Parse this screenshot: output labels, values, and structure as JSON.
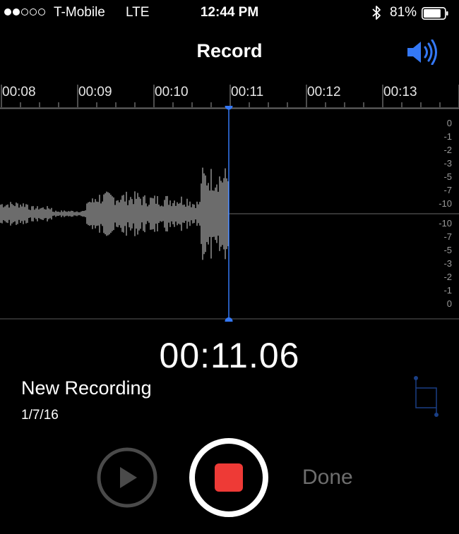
{
  "status_bar": {
    "carrier": "T-Mobile",
    "network": "LTE",
    "time": "12:44 PM",
    "battery_percent": "81%",
    "signal_bars_filled": 2,
    "signal_bars_total": 5,
    "battery_level": 0.81
  },
  "nav": {
    "title": "Record",
    "speaker_icon": "speaker-icon"
  },
  "timeline": {
    "labels": [
      "00:08",
      "00:09",
      "00:10",
      "00:11",
      "00:12",
      "00:13"
    ]
  },
  "meter": {
    "db_labels_top": [
      "0",
      "-1",
      "-2",
      "-3",
      "-5",
      "-7",
      "-10"
    ],
    "db_labels_bottom": [
      "-10",
      "-7",
      "-5",
      "-3",
      "-2",
      "-1",
      "0"
    ]
  },
  "timer": "00:11.06",
  "recording": {
    "name": "New Recording",
    "date": "1/7/16"
  },
  "controls": {
    "done_label": "Done",
    "play_icon": "play-icon",
    "stop_icon": "stop-icon",
    "trim_icon": "trim-icon"
  },
  "colors": {
    "accent": "#3478f6",
    "record_red": "#ee3a36",
    "disabled_gray": "#6e6e6e"
  }
}
